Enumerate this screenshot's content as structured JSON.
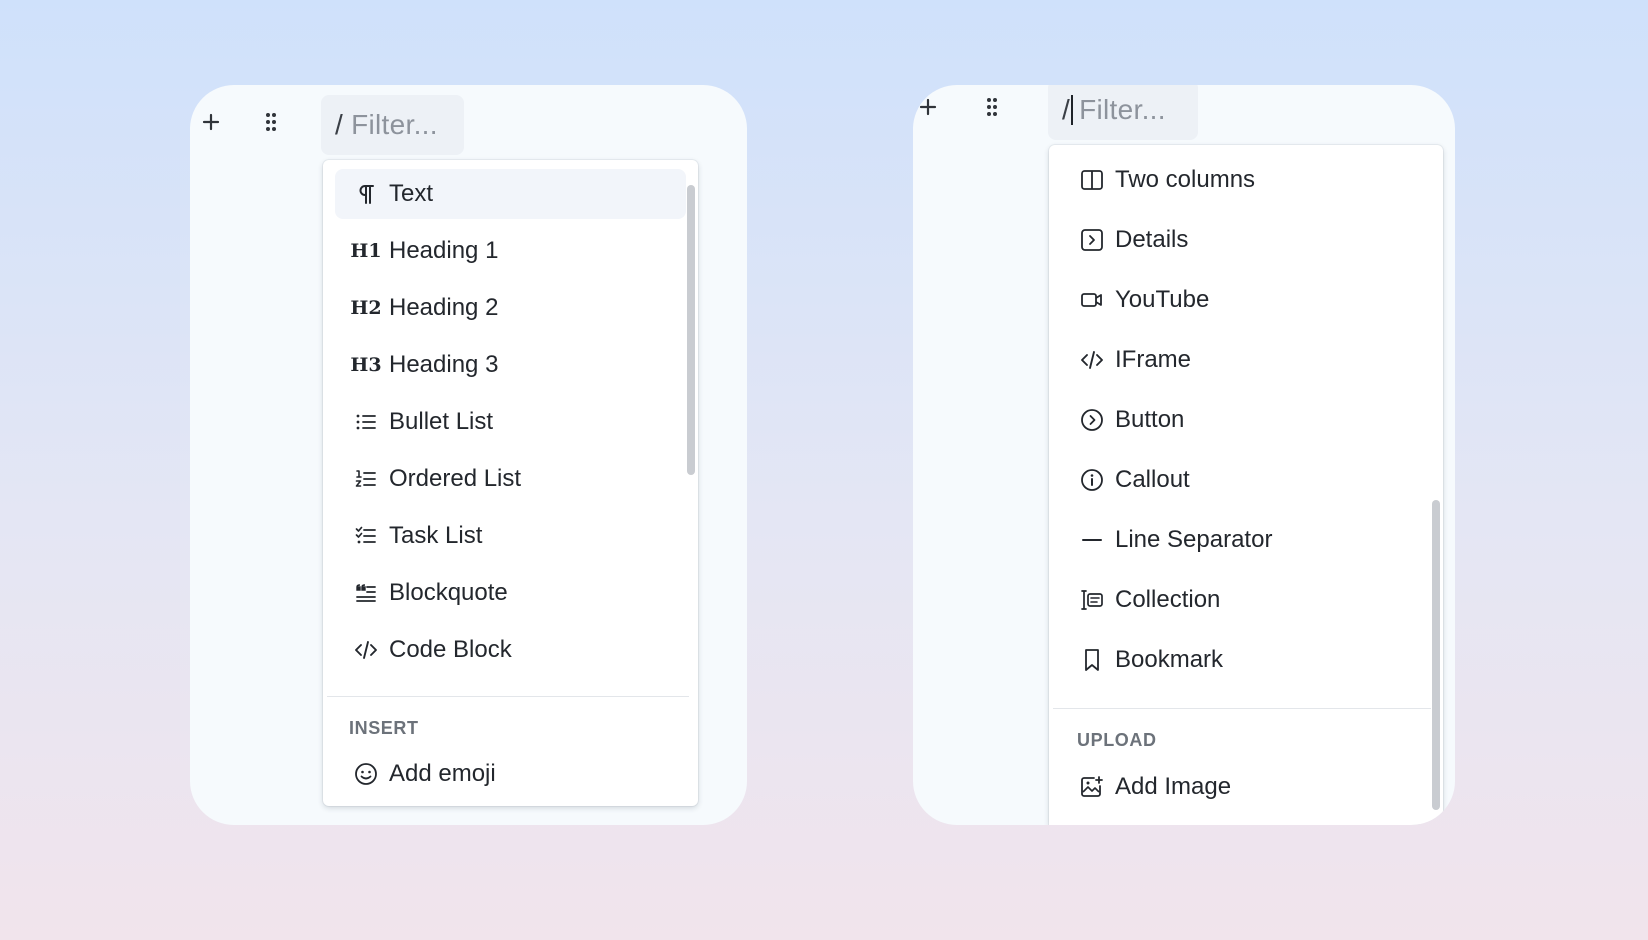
{
  "left_panel": {
    "filter": {
      "prefix": "/",
      "placeholder": "Filter..."
    },
    "items": [
      {
        "label": "Text",
        "icon": "pilcrow-icon",
        "active": true
      },
      {
        "label": "Heading 1",
        "icon": "heading-1-icon"
      },
      {
        "label": "Heading 2",
        "icon": "heading-2-icon"
      },
      {
        "label": "Heading 3",
        "icon": "heading-3-icon"
      },
      {
        "label": "Bullet List",
        "icon": "bullet-list-icon"
      },
      {
        "label": "Ordered List",
        "icon": "ordered-list-icon"
      },
      {
        "label": "Task List",
        "icon": "task-list-icon"
      },
      {
        "label": "Blockquote",
        "icon": "blockquote-icon"
      },
      {
        "label": "Code Block",
        "icon": "code-icon"
      }
    ],
    "section": "INSERT",
    "section_items": [
      {
        "label": "Add emoji",
        "icon": "smiley-icon"
      }
    ],
    "heading_icon_labels": {
      "h1": "H1",
      "h2": "H2",
      "h3": "H3"
    }
  },
  "right_panel": {
    "filter": {
      "prefix": "/",
      "placeholder": "Filter..."
    },
    "items": [
      {
        "label": "Two columns",
        "icon": "columns-icon"
      },
      {
        "label": "Details",
        "icon": "details-icon"
      },
      {
        "label": "YouTube",
        "icon": "video-icon"
      },
      {
        "label": "IFrame",
        "icon": "code-icon"
      },
      {
        "label": "Button",
        "icon": "button-icon"
      },
      {
        "label": "Callout",
        "icon": "info-icon"
      },
      {
        "label": "Line Separator",
        "icon": "minus-icon"
      },
      {
        "label": "Collection",
        "icon": "collection-icon"
      },
      {
        "label": "Bookmark",
        "icon": "bookmark-icon"
      }
    ],
    "section": "UPLOAD",
    "section_items": [
      {
        "label": "Add Image",
        "icon": "add-image-icon"
      }
    ]
  },
  "colors": {
    "card_background": "#f6fafd",
    "active_item": "#f2f5fa",
    "filter_background": "#edf1f6",
    "placeholder_text": "#8d939c",
    "section_label": "#6c727a"
  }
}
